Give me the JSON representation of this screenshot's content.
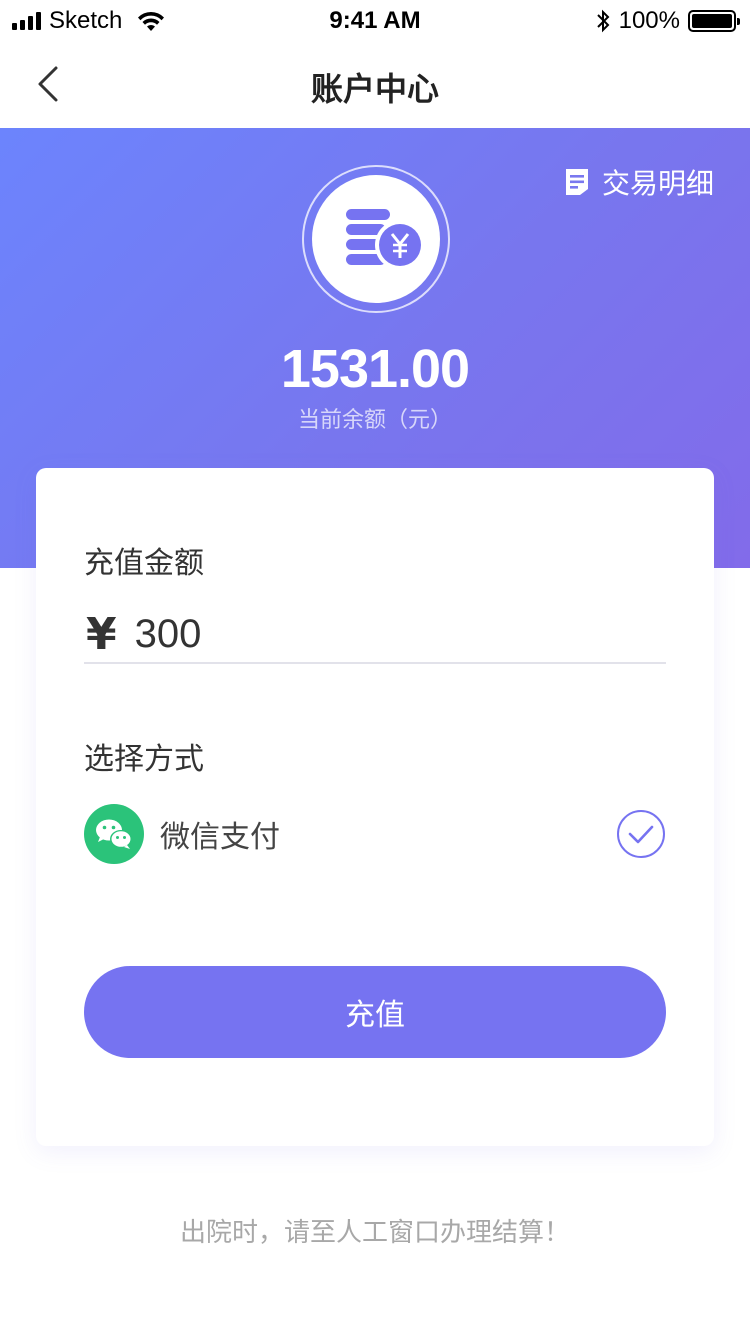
{
  "status_bar": {
    "carrier": "Sketch",
    "time": "9:41 AM",
    "battery": "100%"
  },
  "nav": {
    "title": "账户中心",
    "back_icon": "chevron-left-icon"
  },
  "header": {
    "detail_link": "交易明细",
    "balance": "1531.00",
    "balance_label": "当前余额（元）",
    "gradient_colors": [
      "#6c84fd",
      "#826bea"
    ]
  },
  "recharge": {
    "amount_title": "充值金额",
    "currency_symbol": "¥",
    "amount_value": "300",
    "method_title": "选择方式",
    "method_label": "微信支付",
    "method_selected": true,
    "submit_label": "充值"
  },
  "footer": {
    "note": "出院时，请至人工窗口办理结算！"
  },
  "colors": {
    "accent": "#7673f1",
    "wechat": "#2bc37a"
  }
}
